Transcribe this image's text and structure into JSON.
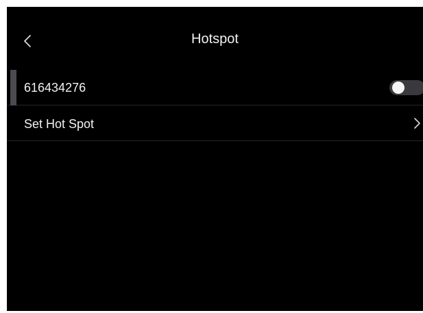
{
  "header": {
    "title": "Hotspot",
    "back_icon": "chevron-left-icon"
  },
  "rows": [
    {
      "label": "616434276",
      "control": "toggle",
      "toggle_on": false
    },
    {
      "label": "Set Hot Spot",
      "control": "chevron-right-icon"
    }
  ],
  "colors": {
    "background": "#000000",
    "text": "#f2f2f2",
    "toggle_track": "#3a3a3e",
    "toggle_knob": "#f5f5f5",
    "row_indicator": "#4a4a4f",
    "divider": "#262626"
  }
}
